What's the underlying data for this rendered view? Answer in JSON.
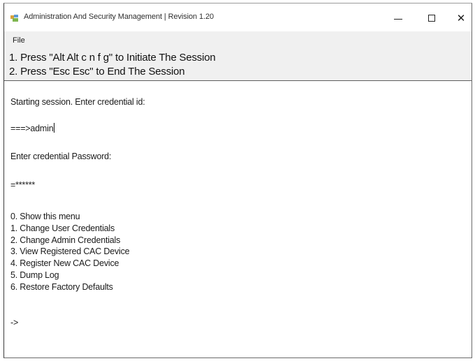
{
  "window": {
    "title": "Administration And Security Management | Revision 1.20",
    "app_icon": "app-icon",
    "controls": {
      "minimize": "minimize-icon",
      "maximize": "maximize-icon",
      "close": "close-icon"
    }
  },
  "menubar": {
    "file_label": "File"
  },
  "instructions": [
    "1. Press \"Alt Alt c n f g\" to Initiate The Session",
    "2. Press \"Esc Esc\" to End The Session"
  ],
  "console": {
    "line_starting": "Starting session. Enter credential id:",
    "line_id_input": "===>admin",
    "line_password_prompt": "Enter credential Password:",
    "line_password_input": "=******",
    "menu_items": [
      {
        "num": "0.",
        "label": "Show this menu"
      },
      {
        "num": "1.",
        "label": "Change User Credentials"
      },
      {
        "num": "2.",
        "label": "Change Admin Credentials"
      },
      {
        "num": "3.",
        "label": "View Registered CAC Device"
      },
      {
        "num": "4.",
        "label": "Register New CAC Device"
      },
      {
        "num": "5.",
        "label": "Dump Log"
      },
      {
        "num": "6.",
        "label": "Restore Factory Defaults"
      }
    ],
    "prompt": "->"
  },
  "colors": {
    "header_bg": "#f0f0f0",
    "console_bg": "#ffffff",
    "text": "#1a1a1a"
  }
}
